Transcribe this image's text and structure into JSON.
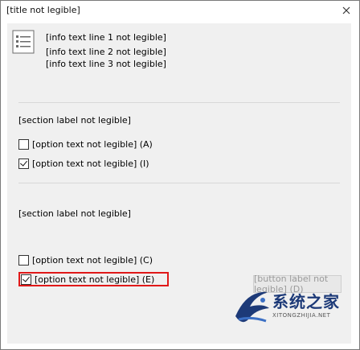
{
  "window": {
    "title": "[title not legible]",
    "close_glyph": "✕"
  },
  "info": {
    "icon": "document-list-icon",
    "line1": "[info text line 1 not legible]",
    "line2": "[info text line 2 not legible]",
    "line3": "[info text line 3 not legible]"
  },
  "section1": {
    "label": "[section label not legible]",
    "options": [
      {
        "text": "[option text not legible] (A)",
        "checked": false
      },
      {
        "text": "[option text not legible] (I)",
        "checked": true
      }
    ]
  },
  "section2": {
    "label": "[section label not legible]",
    "options": [
      {
        "text": "[option text not legible] (C)",
        "checked": false
      },
      {
        "text": "[option text not legible] (E)",
        "checked": true
      }
    ]
  },
  "details_button": {
    "label": "[button label not legible] (D)"
  },
  "watermark": {
    "logo_cn": "系统之家",
    "logo_en": "XITONGZHIJIA.NET",
    "icon": "xi-logo-icon"
  },
  "colors": {
    "highlight": "#e01818",
    "logo_blue": "#1d3a78"
  }
}
